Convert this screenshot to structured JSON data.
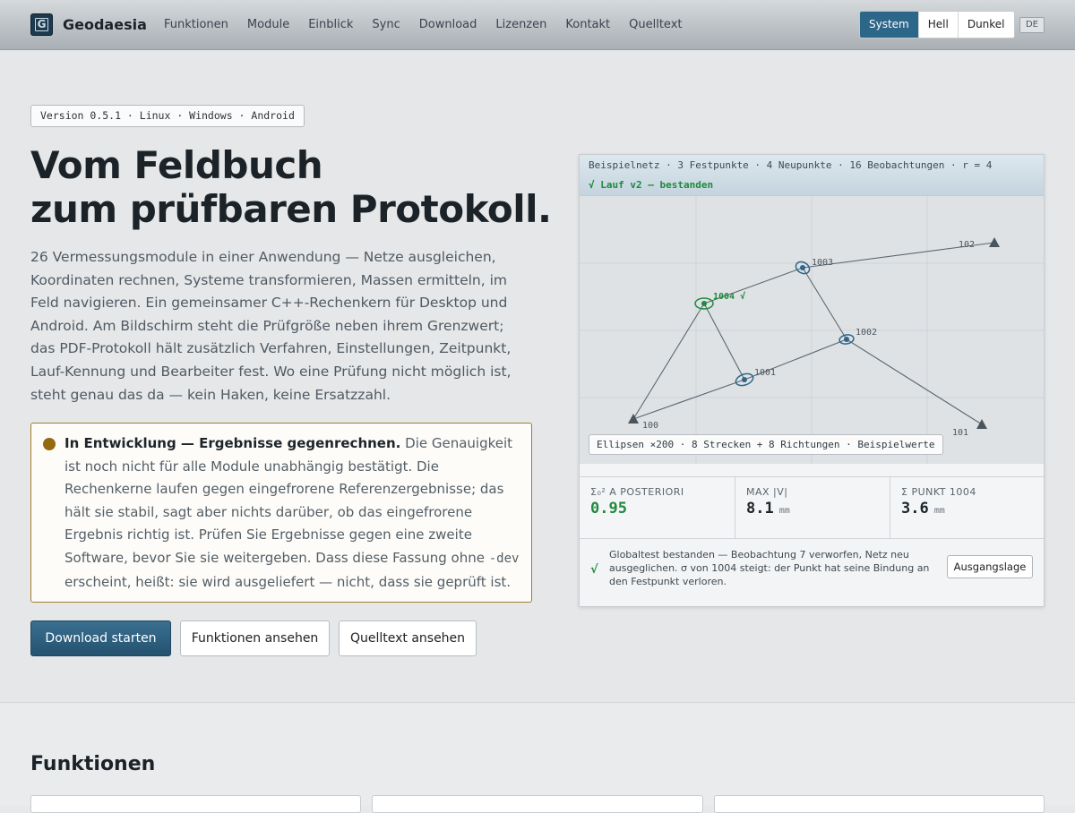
{
  "header": {
    "brand": "Geodaesia",
    "logo_letter": "G",
    "nav": [
      "Funktionen",
      "Module",
      "Einblick",
      "Sync",
      "Download",
      "Lizenzen",
      "Kontakt",
      "Quelltext"
    ],
    "theme": {
      "options": [
        "System",
        "Hell",
        "Dunkel"
      ],
      "selected": "System"
    },
    "language": "DE"
  },
  "hero": {
    "version": "Version 0.5.1 · Linux · Windows · Android",
    "title_line1": "Vom Feldbuch",
    "title_line2": "zum prüfbaren Protokoll.",
    "intro": "26 Vermessungsmodule in einer Anwendung — Netze ausgleichen, Koordinaten rechnen, Systeme transformieren, Massen ermitteln, im Feld navigieren. Ein gemeinsamer C++-Rechenkern für Desktop und Android. Am Bildschirm steht die Prüfgröße neben ihrem Grenzwert; das PDF-Protokoll hält zusätzlich Verfahren, Einstellungen, Zeitpunkt, Lauf-Kennung und Bearbeiter fest. Wo eine Prüfung nicht möglich ist, steht genau das da — kein Haken, keine Ersatzzahl.",
    "notice": {
      "heading": "In Entwicklung — Ergebnisse gegenrechnen.",
      "body_1": "Die Genauigkeit ist noch nicht für alle Module unabhängig bestätigt. Die Rechenkerne laufen gegen eingefrorene Referenzergebnisse; das hält sie stabil, sagt aber nichts darüber, ob das eingefrorene Ergebnis richtig ist. Prüfen Sie Ergebnisse gegen eine zweite Software, bevor Sie sie weitergeben. Dass diese Fassung ohne ",
      "code": "-dev",
      "body_2": " erscheint, heißt: sie wird ausgeliefert — nicht, dass sie geprüft ist.",
      "color": "#94690f"
    },
    "buttons": {
      "primary": "Download starten",
      "features": "Funktionen ansehen",
      "source": "Quelltext ansehen"
    }
  },
  "demo": {
    "header_line": "Beispielnetz · 3 Festpunkte · 4 Neupunkte · 16 Beobachtungen · r = 4",
    "status_line": "√ Lauf v2 — bestanden",
    "status_color": "#1f8a3d",
    "network": {
      "control_points": [
        {
          "id": "100"
        },
        {
          "id": "101"
        },
        {
          "id": "102"
        }
      ],
      "new_points": [
        {
          "id": "1001"
        },
        {
          "id": "1002"
        },
        {
          "id": "1003"
        },
        {
          "id": "1004 √",
          "highlight": true
        }
      ],
      "lines": [
        [
          "100",
          "1004"
        ],
        [
          "100",
          "1001"
        ],
        [
          "1001",
          "1004"
        ],
        [
          "1001",
          "1002"
        ],
        [
          "1002",
          "1003"
        ],
        [
          "1002",
          "101"
        ],
        [
          "1003",
          "1004"
        ],
        [
          "1003",
          "102"
        ]
      ]
    },
    "caption": "Ellipsen ×200 · 8 Strecken + 8 Richtungen · Beispielwerte",
    "stats": [
      {
        "label": "Σ₀² A POSTERIORI",
        "value": "0.95",
        "unit": "",
        "green": true
      },
      {
        "label": "MAX |V|",
        "value": "8.1",
        "unit": "mm",
        "green": false
      },
      {
        "label": "Σ PUNKT 1004",
        "value": "3.6",
        "unit": "mm",
        "green": false
      }
    ],
    "footer": {
      "check": "√",
      "text": "Globaltest bestanden — Beobachtung 7 verworfen, Netz neu ausgeglichen. σ von 1004 steigt: der Punkt hat seine Bindung an den Festpunkt verloren.",
      "button": "Ausgangslage"
    }
  },
  "features": {
    "title": "Funktionen"
  }
}
